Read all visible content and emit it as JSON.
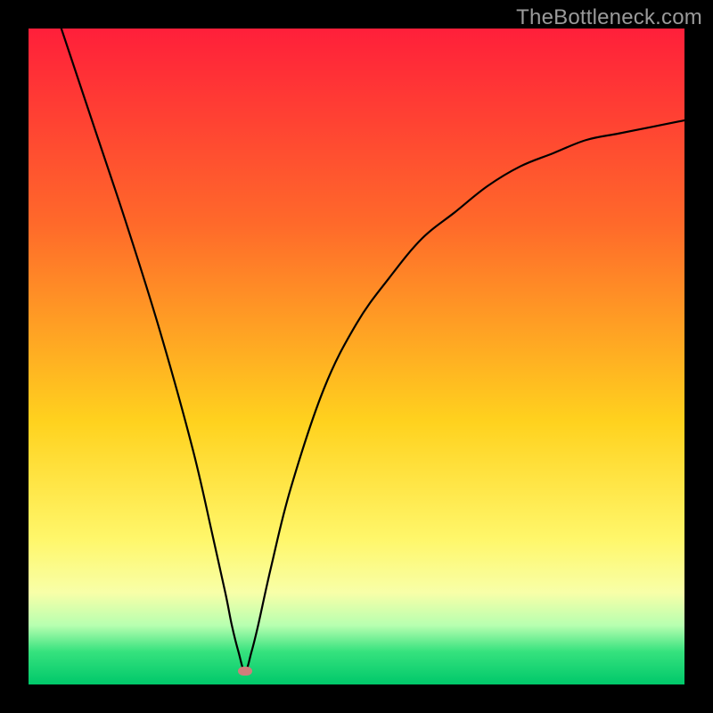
{
  "watermark": "TheBottleneck.com",
  "colors": {
    "frame": "#000000",
    "gradient_top": "#ff1f3a",
    "gradient_mid1": "#ff6a2a",
    "gradient_mid2": "#ffd21e",
    "gradient_mid3": "#fff76b",
    "gradient_mid4": "#f8ffa8",
    "gradient_mid5": "#b7ffb0",
    "gradient_mid6": "#36e27e",
    "gradient_bottom": "#00c86a",
    "curve": "#000000",
    "marker": "#cf7d7b"
  },
  "chart_data": {
    "type": "line",
    "title": "",
    "xlabel": "",
    "ylabel": "",
    "xlim": [
      0,
      100
    ],
    "ylim": [
      0,
      100
    ],
    "grid": false,
    "legend": false,
    "marker": {
      "x": 33,
      "y": 2
    },
    "series": [
      {
        "name": "bottleneck-curve",
        "x": [
          5,
          10,
          15,
          20,
          25,
          28,
          30,
          31,
          32,
          33,
          34,
          35,
          37,
          40,
          45,
          50,
          55,
          60,
          65,
          70,
          75,
          80,
          85,
          90,
          95,
          100
        ],
        "y": [
          100,
          85,
          70,
          54,
          36,
          23,
          14,
          9,
          5,
          2,
          5,
          9,
          18,
          30,
          45,
          55,
          62,
          68,
          72,
          76,
          79,
          81,
          83,
          84,
          85,
          86
        ]
      }
    ],
    "annotations": []
  }
}
